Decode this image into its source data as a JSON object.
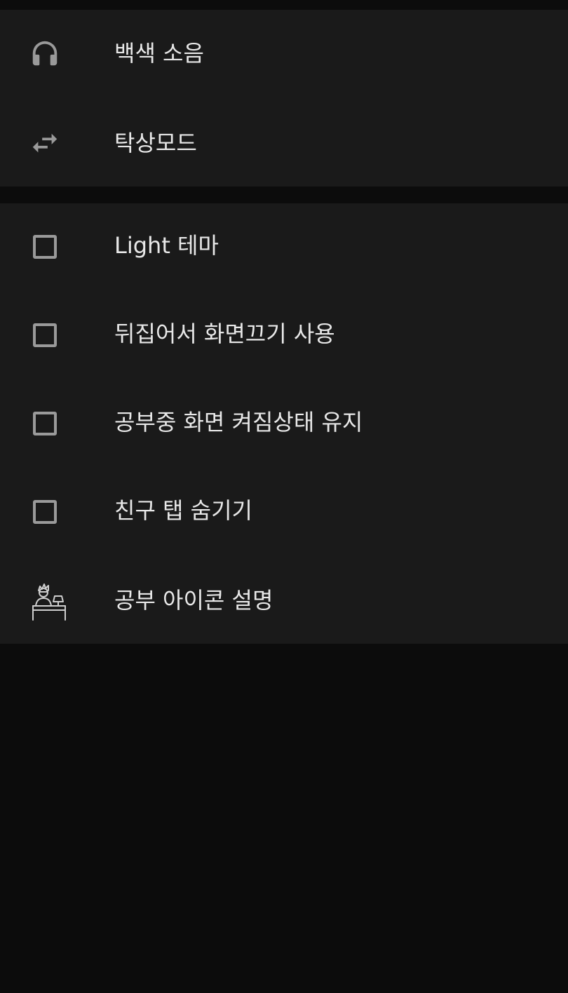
{
  "sound_section": {
    "items": [
      {
        "label": "백색 소음",
        "icon": "headphones-icon"
      },
      {
        "label": "탁상모드",
        "icon": "swap-arrows-icon"
      }
    ]
  },
  "settings_section": {
    "items": [
      {
        "label": "Light 테마",
        "checked": false
      },
      {
        "label": "뒤집어서 화면끄기 사용",
        "checked": false
      },
      {
        "label": "공부중 화면 켜짐상태 유지",
        "checked": false
      },
      {
        "label": "친구 탭 숨기기",
        "checked": false
      }
    ],
    "study_icon_item": {
      "label": "공부 아이콘 설명",
      "icon": "studying-person-icon"
    }
  },
  "colors": {
    "background": "#0c0c0c",
    "panel": "#1a1a1a",
    "text": "#e8e8e8",
    "icon": "#9a9a9a"
  }
}
